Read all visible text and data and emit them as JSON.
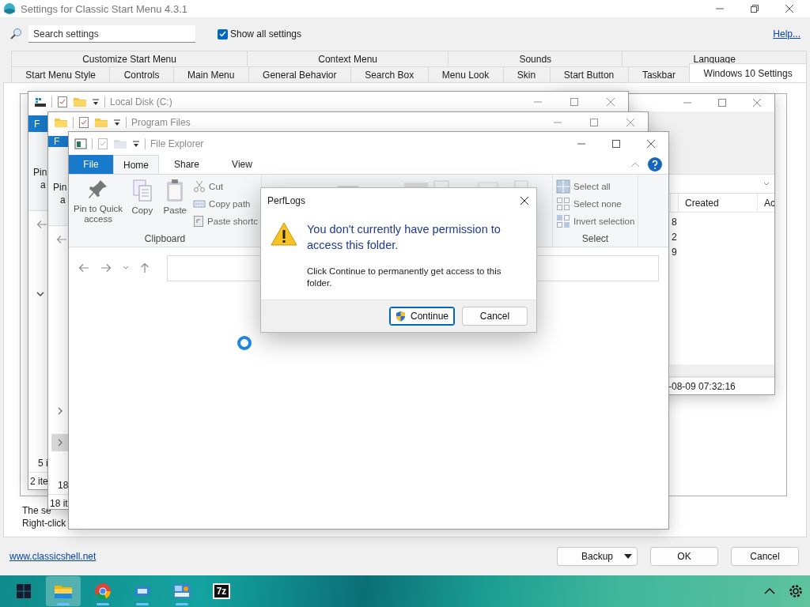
{
  "settings_window": {
    "title": "Settings for Classic Start Menu 4.3.1",
    "search": {
      "placeholder": "Search settings"
    },
    "show_all": {
      "label": "Show all settings",
      "checked": true
    },
    "help_link": "Help...",
    "tab_rows": [
      [
        {
          "label": "Customize Start Menu",
          "selected": false
        },
        {
          "label": "Context Menu",
          "selected": false
        },
        {
          "label": "Sounds",
          "selected": false
        },
        {
          "label": "Language",
          "selected": false
        }
      ],
      [
        {
          "label": "Start Menu Style",
          "selected": false
        },
        {
          "label": "Controls",
          "selected": false
        },
        {
          "label": "Main Menu",
          "selected": false
        },
        {
          "label": "General Behavior",
          "selected": false
        },
        {
          "label": "Search Box",
          "selected": false
        },
        {
          "label": "Menu Look",
          "selected": false
        },
        {
          "label": "Skin",
          "selected": false
        },
        {
          "label": "Start Button",
          "selected": false
        },
        {
          "label": "Taskbar",
          "selected": false
        },
        {
          "label": "Windows 10 Settings",
          "selected": true
        }
      ]
    ],
    "description_lines": [
      "The se",
      "Right-click"
    ],
    "website_link": "www.classicshell.net",
    "buttons": [
      {
        "label": "Backup",
        "kind": "split"
      },
      {
        "label": "OK",
        "kind": "plain"
      },
      {
        "label": "Cancel",
        "kind": "plain"
      }
    ]
  },
  "right_window": {
    "columns": [
      "Created",
      "Ac"
    ],
    "cells": [
      "8",
      "2",
      "9"
    ],
    "status": "-08-09 07:32:16"
  },
  "back_windows": [
    {
      "kind": "drive",
      "title": "Local Disk (C:)",
      "file_tab": "F",
      "ribbon_fragments": [
        "Pin",
        "a"
      ],
      "tree_toggles": [
        {
          "expanded": true,
          "selected": false
        }
      ],
      "pane_fragment": "5 i",
      "status": "2 ite"
    },
    {
      "kind": "folder",
      "title": "Program Files",
      "file_tab": "F",
      "ribbon_fragments": [
        "Pin",
        "a"
      ],
      "tree_toggles": [
        {
          "expanded": false,
          "selected": false
        },
        {
          "expanded": false,
          "selected": true
        }
      ],
      "pane_fragment": "18",
      "status": "18 it"
    }
  ],
  "file_explorer": {
    "title": "File Explorer",
    "ribbon_tabs": [
      {
        "label": "File",
        "kind": "file",
        "selected": false
      },
      {
        "label": "Home",
        "kind": "tab",
        "selected": true
      },
      {
        "label": "Share",
        "kind": "tab",
        "selected": false
      },
      {
        "label": "View",
        "kind": "tab",
        "selected": false
      }
    ],
    "ribbon_groups": [
      {
        "label": "Clipboard",
        "items": [
          {
            "label": "Pin to Quick access",
            "kind": "large"
          },
          {
            "label": "Copy",
            "kind": "large"
          },
          {
            "label": "Paste",
            "kind": "large"
          },
          {
            "label": "Cut",
            "kind": "small"
          },
          {
            "label": "Copy path",
            "kind": "small"
          },
          {
            "label": "Paste shortc",
            "kind": "small"
          }
        ]
      },
      {
        "label": "Select",
        "items": [
          {
            "label": "Select all",
            "kind": "small"
          },
          {
            "label": "Select none",
            "kind": "small"
          },
          {
            "label": "Invert selection",
            "kind": "small"
          }
        ]
      }
    ],
    "loading": true
  },
  "dialog": {
    "title": "PerfLogs",
    "heading": "You don't currently have permission to access this folder.",
    "message": "Click Continue to permanently get access to this folder.",
    "buttons": [
      {
        "label": "Continue",
        "kind": "shield",
        "default": true
      },
      {
        "label": "Cancel",
        "kind": "plain",
        "default": false
      }
    ]
  },
  "taskbar": {
    "items": [
      {
        "kind": "start",
        "running": false,
        "selected": false
      },
      {
        "kind": "folder",
        "running": true,
        "selected": true
      },
      {
        "kind": "browser",
        "running": true,
        "selected": false
      },
      {
        "kind": "app",
        "running": true,
        "selected": false
      },
      {
        "kind": "panel",
        "running": true,
        "selected": false
      },
      {
        "kind": "archive",
        "label": "7z",
        "running": false,
        "selected": false
      }
    ]
  }
}
